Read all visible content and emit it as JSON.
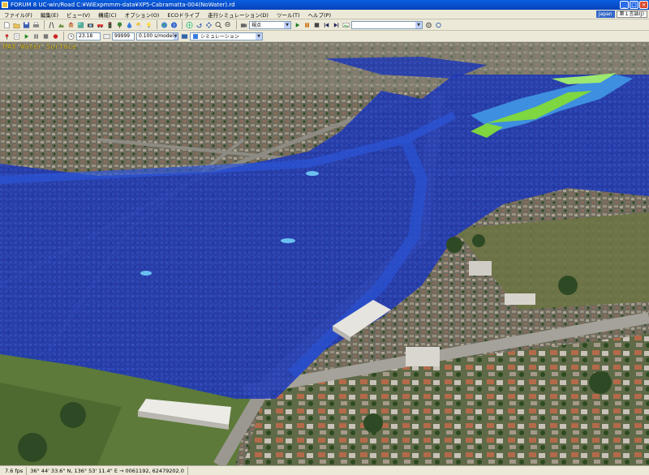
{
  "window": {
    "title": "FORUM 8 UC-win/Road C:¥WiExpmmm-data¥XP5-Cabramatta-004(NoWater).rd"
  },
  "menu": [
    "ファイル(F)",
    "編集(E)",
    "ビュー(V)",
    "構成(C)",
    "オプション(O)",
    "ECOドライブ",
    "走行シミュレーション(D)",
    "ツール(T)",
    "ヘルプ(P)"
  ],
  "menu_right": {
    "lang_button": "Japan",
    "lang_label": "第１言語(J)"
  },
  "toolbar1": {
    "view_combo": "視点"
  },
  "toolbar2": {
    "frame_value": "23.18",
    "count_value": "99999",
    "speed_combo": "0.100 s/model",
    "sim_combo": "シミュレーション"
  },
  "overlay": {
    "label": "MAX Water Surface"
  },
  "status": {
    "fps": "7.6 fps",
    "coords": "36°  44' 33.6\" N, 136°  53' 11.4\" E   →   0061192, 62479202.0"
  },
  "colors": {
    "flood_blue": "#1e3cb8",
    "flood_light": "#3e8fe0",
    "flood_green": "#7ed640",
    "overlay_text": "#e6c62a"
  }
}
